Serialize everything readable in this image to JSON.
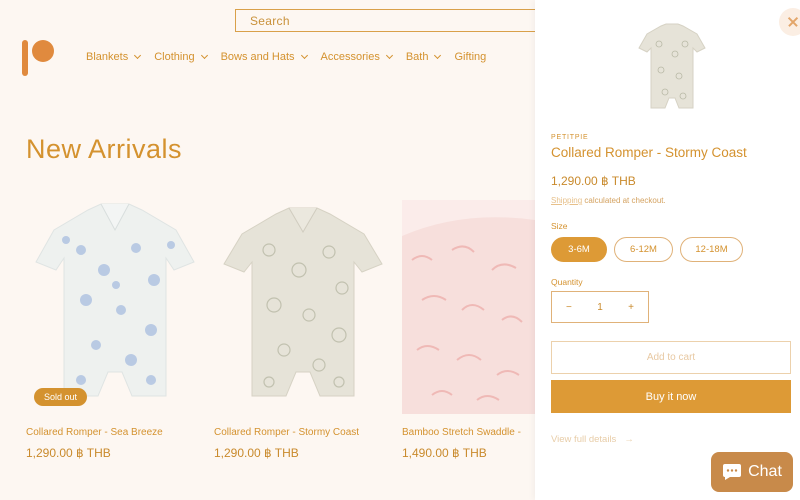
{
  "header": {
    "search_placeholder": "Search",
    "nav": [
      "Blankets",
      "Clothing",
      "Bows and Hats",
      "Accessories",
      "Bath",
      "Gifting"
    ]
  },
  "section": {
    "title": "New Arrivals",
    "products": [
      {
        "name": "Collared Romper - Sea Breeze",
        "price": "1,290.00 ฿ THB",
        "badge": "Sold out"
      },
      {
        "name": "Collared Romper - Stormy Coast",
        "price": "1,290.00 ฿ THB"
      },
      {
        "name": "Bamboo Stretch Swaddle -",
        "price": "1,490.00 ฿ THB"
      }
    ]
  },
  "drawer": {
    "vendor": "PETITPIE",
    "title": "Collared Romper - Stormy Coast",
    "price": "1,290.00 ฿ THB",
    "shipping_link": "Shipping",
    "shipping_text": " calculated at checkout.",
    "size_label": "Size",
    "sizes": [
      "3-6M",
      "6-12M",
      "12-18M"
    ],
    "selected_size": "3-6M",
    "quantity_label": "Quantity",
    "quantity_value": "1",
    "minus": "−",
    "plus": "+",
    "add_to_cart": "Add to cart",
    "buy_now": "Buy it now",
    "view_full": "View full details",
    "view_full_arrow": "→"
  },
  "chat": {
    "label": "Chat"
  },
  "colors": {
    "accent": "#dd9a36",
    "background": "#fdf7f2"
  }
}
